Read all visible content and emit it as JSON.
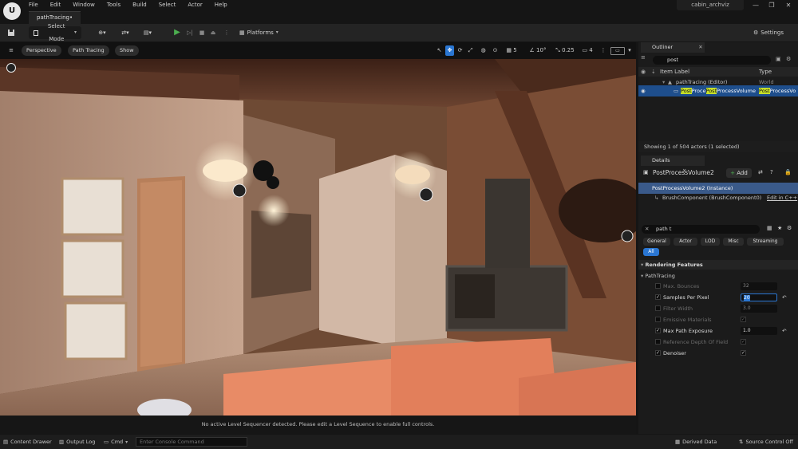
{
  "menu": [
    "File",
    "Edit",
    "Window",
    "Tools",
    "Build",
    "Select",
    "Actor",
    "Help"
  ],
  "project_tab": "pathTracing•",
  "project_name": "cabin_archviz",
  "toolbar": {
    "select_mode": "Select Mode",
    "platforms": "Platforms",
    "settings": "Settings"
  },
  "viewport": {
    "perspective": "Perspective",
    "view_mode": "Path Tracing",
    "show": "Show",
    "grid_value": "5",
    "angle_value": "10°",
    "scale_value": "0.25",
    "camera_speed": "4",
    "sequencer_message": "No active Level Sequencer detected. Please edit a Level Sequence to enable full controls."
  },
  "outliner": {
    "tab": "Outliner",
    "search_value": "post",
    "col_label": "Item Label",
    "col_type": "Type",
    "items": [
      {
        "label": "pathTracing (Editor)",
        "type": "World"
      },
      {
        "label_parts": [
          "Post",
          "Proce",
          "Post",
          "ProcessVolume"
        ],
        "type_parts": [
          "Post",
          "ProcessVo"
        ]
      }
    ],
    "status": "Showing 1 of 504 actors (1 selected)"
  },
  "details": {
    "tab": "Details",
    "object_name": "PostProcessVolume2",
    "add_label": "Add",
    "components": [
      {
        "label": "PostProcessVolume2 (Instance)"
      },
      {
        "label": "BrushComponent (BrushComponent0)",
        "action": "Edit in C++"
      }
    ],
    "search_value": "path t",
    "filters": [
      "General",
      "Actor",
      "LOD",
      "Misc",
      "Streaming",
      "All"
    ],
    "section": "Rendering Features",
    "group": "PathTracing",
    "properties": [
      {
        "label": "Max. Bounces",
        "value": "32",
        "enabled": false,
        "checked": false
      },
      {
        "label": "Samples Per Pixel",
        "value": "20",
        "enabled": true,
        "checked": true
      },
      {
        "label": "Filter Width",
        "value": "3.0",
        "enabled": false,
        "checked": false
      },
      {
        "label": "Emissive Materials",
        "value": "",
        "enabled": false,
        "checked": false
      },
      {
        "label": "Max Path Exposure",
        "value": "1.0",
        "enabled": true,
        "checked": true
      },
      {
        "label": "Reference Depth Of Field",
        "value": "",
        "enabled": false,
        "checked": false
      },
      {
        "label": "Denoiser",
        "value": "",
        "enabled": true,
        "checked": true
      }
    ]
  },
  "bottombar": {
    "content_drawer": "Content Drawer",
    "output_log": "Output Log",
    "cmd": "Cmd",
    "console_placeholder": "Enter Console Command",
    "derived_data": "Derived Data",
    "source_control": "Source Control Off"
  },
  "colors": {
    "accent": "#2a76d2",
    "highlight": "#c7e02a",
    "play": "#4caf50"
  }
}
